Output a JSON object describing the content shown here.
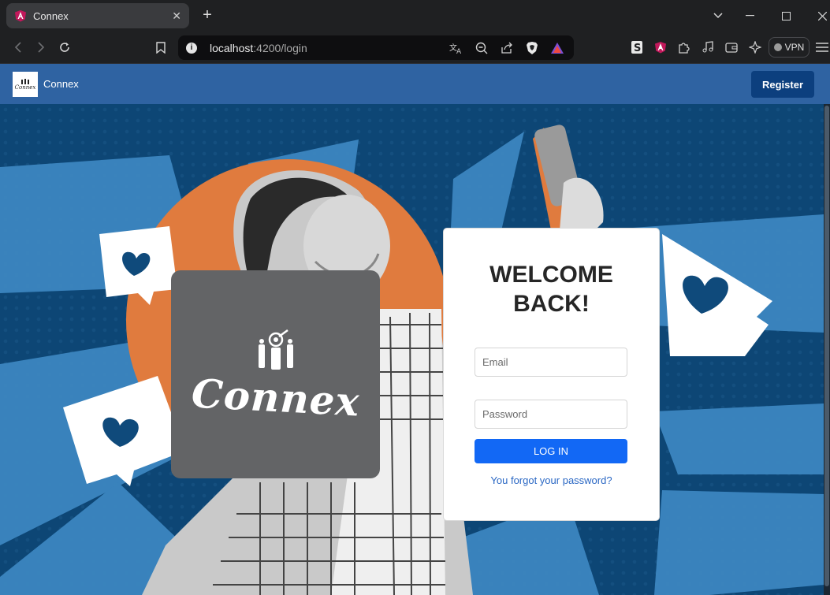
{
  "browser": {
    "tab_title": "Connex",
    "tab_close": "✕",
    "new_tab": "+",
    "url_host": "localhost",
    "url_path": ":4200/login",
    "vpn_label": "VPN"
  },
  "header": {
    "brand_name": "Connex",
    "logo_text": "Connex",
    "register_label": "Register"
  },
  "hero": {
    "logo_title": "Connex"
  },
  "login": {
    "heading_line1": "WELCOME",
    "heading_line2": "BACK!",
    "email_placeholder": "Email",
    "password_placeholder": "Password",
    "login_label": "LOG IN",
    "forgot_label": "You forgot your password?"
  },
  "colors": {
    "header_bg": "#2f63a2",
    "register_bg": "#0c3f7e",
    "login_button": "#1268f5",
    "link": "#2b68c4",
    "logo_card": "#636466",
    "hero_orange": "#e07b3e",
    "hero_blue": "#3c86c0"
  }
}
